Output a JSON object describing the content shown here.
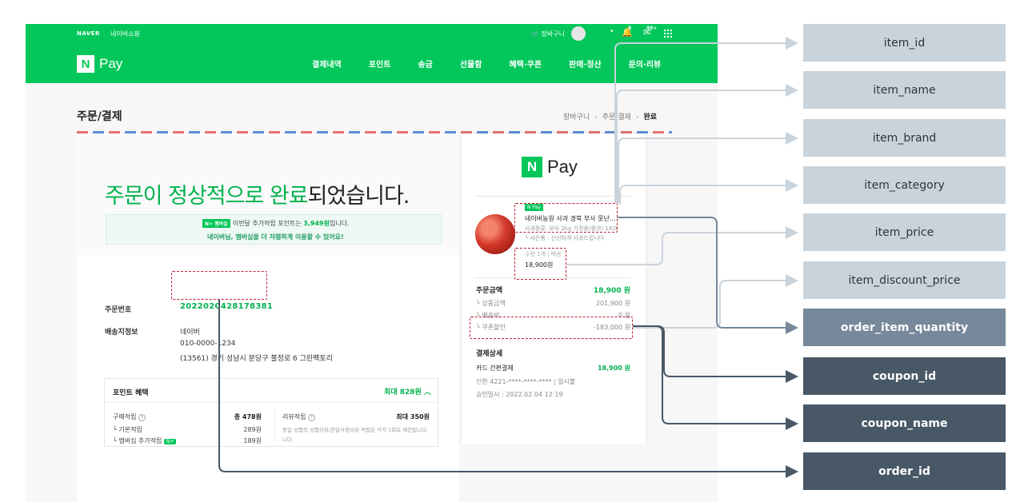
{
  "topbar": {
    "naver": "NAVER",
    "shopping": "네이버쇼핑",
    "cart": "장바구니",
    "bell_count": "8",
    "mail_count": "99+",
    "icons": [
      "cart-icon",
      "avatar",
      "bell-icon",
      "mail-icon",
      "apps-grid-icon"
    ]
  },
  "brand": {
    "n": "N",
    "pay": "Pay"
  },
  "nav": [
    "결제내역",
    "포인트",
    "송금",
    "선물함",
    "혜택·쿠폰",
    "판매·정산",
    "문의·리뷰"
  ],
  "page": {
    "title": "주문/결제",
    "breadcrumb": [
      "장바구니",
      "주문/결제",
      "완료"
    ]
  },
  "hero": {
    "headline_green": "주문이 정상적으로 완료",
    "headline_rest": "되었습니다.",
    "promo_badge": "N+ 멤버십",
    "promo_line1_pre": "이번달 추가적립 포인트는",
    "promo_line1_points": "3,949원",
    "promo_line1_post": "입니다.",
    "promo_line2": "네이버님, 멤버십을 더 저렴하게 이용할 수 있어요!"
  },
  "order": {
    "order_no_label": "주문번호",
    "order_no": "2022020428178381",
    "shipping_label": "배송지정보",
    "ship_name": "네이버",
    "ship_phone": "010-0000-1234",
    "ship_address": "(13561) 경기 성남시 분당구 불정로 6 그린팩토리"
  },
  "points": {
    "title": "포인트 혜택",
    "max": "최대 828원",
    "purchase_label": "구매적립",
    "purchase_total": "총 478원",
    "basic_label": "기본적립",
    "basic_value": "289원",
    "membership_label": "멤버십 추가적립",
    "membership_value": "189원",
    "review_label": "리뷰적립",
    "review_total": "최대 350원",
    "review_desc_1": "동일 상품의 상품리뷰/한달사용리뷰 적립은 각각 1회로 제한됩니다.",
    "review_desc_2": "니다."
  },
  "receipt": {
    "badge": "N Pay",
    "item_name": "네이버농원 사과 경북 부사 못난…",
    "option_1": "사과종류: 부사 2kg 가정용(중과) 18과",
    "option_2": "사은품 : 신선하게 사과드립니다",
    "qty": "수량 1개 | 배송",
    "price": "18,900원",
    "order_amount_label": "주문금액",
    "order_amount": "18,900 원",
    "product_amount_label": "상품금액",
    "product_amount": "201,900 원",
    "shipping_label": "배송비",
    "shipping": "0 원",
    "coupon_label": "쿠폰할인",
    "coupon": "-183,000 원",
    "payment_label": "결제상세",
    "card_label": "카드 간편결제",
    "card_amount": "18,900 원",
    "card_info": "신한 4221-****-****-**** | 일시불",
    "approved": "승인일시 : 2022.02.04 12:19"
  },
  "fields": [
    "item_id",
    "item_name",
    "item_brand",
    "item_category",
    "item_price",
    "item_discount_price",
    "order_item_quantity",
    "coupon_id",
    "coupon_name",
    "order_id"
  ],
  "colors": {
    "naver_green": "#03c75a",
    "highlight_red": "#b8222e",
    "tag_light": "#c9d3db",
    "tag_mid": "#76889a",
    "tag_dark": "#485866"
  }
}
